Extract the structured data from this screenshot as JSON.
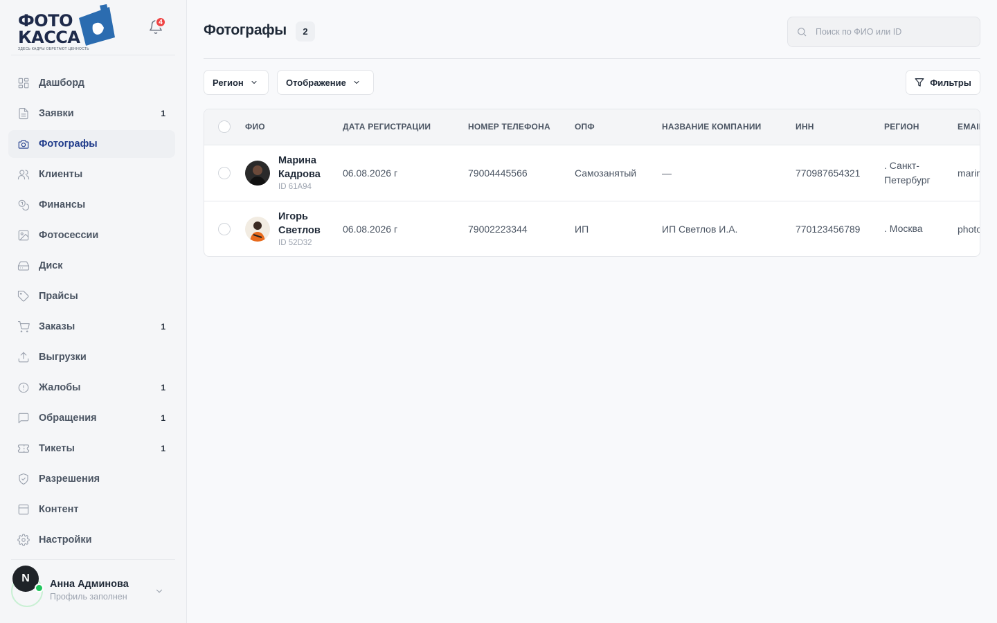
{
  "brand": {
    "logo_line1": "ФОТО",
    "logo_line2": "КАССА",
    "logo_tagline": "ЗДЕСЬ КАДРЫ ОБРЕТАЮТ ЦЕННОСТЬ",
    "accent_color": "#1e3a8a",
    "logo_accent_color": "#2b6cb0"
  },
  "notifications": {
    "icon": "bell-icon",
    "count": "4"
  },
  "sidebar": {
    "items": [
      {
        "label": "Дашборд",
        "icon": "grid-icon",
        "count": ""
      },
      {
        "label": "Заявки",
        "icon": "document-icon",
        "count": "1"
      },
      {
        "label": "Фотографы",
        "icon": "camera-icon",
        "count": "",
        "active": true
      },
      {
        "label": "Клиенты",
        "icon": "users-icon",
        "count": ""
      },
      {
        "label": "Финансы",
        "icon": "coins-icon",
        "count": ""
      },
      {
        "label": "Фотосессии",
        "icon": "image-icon",
        "count": ""
      },
      {
        "label": "Диск",
        "icon": "drive-icon",
        "count": ""
      },
      {
        "label": "Прайсы",
        "icon": "tag-icon",
        "count": ""
      },
      {
        "label": "Заказы",
        "icon": "cart-icon",
        "count": "1"
      },
      {
        "label": "Выгрузки",
        "icon": "upload-icon",
        "count": ""
      },
      {
        "label": "Жалобы",
        "icon": "alert-icon",
        "count": "1"
      },
      {
        "label": "Обращения",
        "icon": "message-icon",
        "count": "1"
      },
      {
        "label": "Тикеты",
        "icon": "ticket-icon",
        "count": "1"
      },
      {
        "label": "Разрешения",
        "icon": "shield-icon",
        "count": ""
      },
      {
        "label": "Контент",
        "icon": "layout-icon",
        "count": ""
      },
      {
        "label": "Настройки",
        "icon": "gear-icon",
        "count": ""
      }
    ]
  },
  "user": {
    "initial": "N",
    "name": "Анна Админова",
    "status": "Профиль заполнен"
  },
  "header": {
    "title": "Фотографы",
    "count": "2",
    "search_placeholder": "Поиск по ФИО или ID"
  },
  "toolbar": {
    "region_label": "Регион",
    "view_label": "Отображение",
    "filters_label": "Фильтры"
  },
  "table": {
    "columns": [
      "ФИО",
      "ДАТА РЕГИСТРАЦИИ",
      "НОМЕР ТЕЛЕФОНА",
      "ОПФ",
      "НАЗВАНИЕ КОМПАНИИ",
      "ИНН",
      "РЕГИОН",
      "EMAIL"
    ],
    "rows": [
      {
        "first_name": "Марина",
        "last_name": "Кадрова",
        "id": "ID 61A94",
        "date": "06.08.2026 г",
        "phone": "79004445566",
        "opf": "Самозанятый",
        "company": "—",
        "inn": "770987654321",
        "region_line1": ". Санкт-",
        "region_line2": "Петербург",
        "email": "marina.kadrova@example.com"
      },
      {
        "first_name": "Игорь",
        "last_name": "Светлов",
        "id": "ID 52D32",
        "date": "06.08.2026 г",
        "phone": "79002223344",
        "opf": "ИП",
        "company": "ИП Светлов И.А.",
        "inn": "770123456789",
        "region_line1": ". Москва",
        "region_line2": "",
        "email": "photo.svetlov@example.com"
      }
    ]
  }
}
